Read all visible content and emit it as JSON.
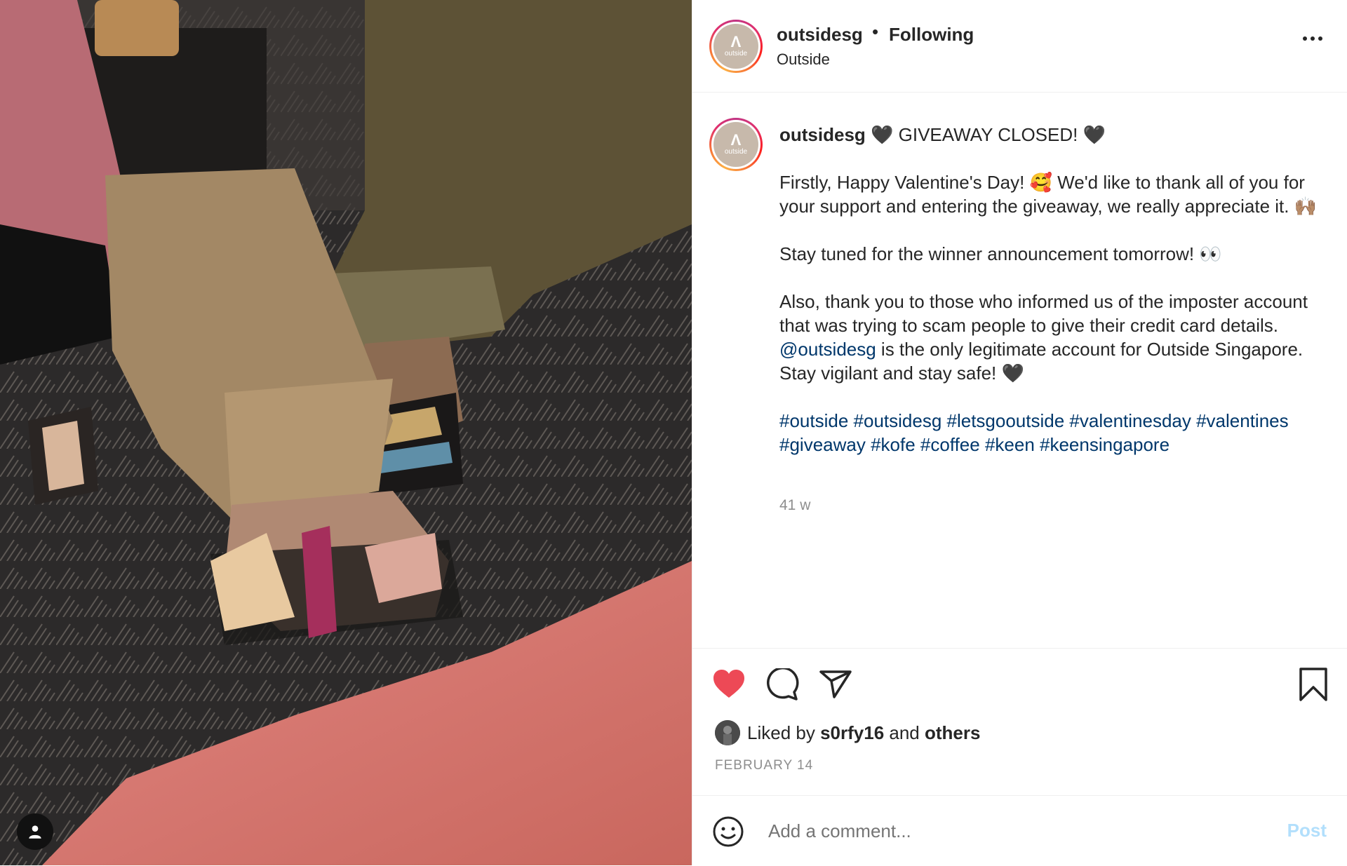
{
  "header": {
    "username": "outsidesg",
    "separator": "•",
    "follow_status": "Following",
    "location": "Outside",
    "avatar_text": "outside",
    "avatar_mark": "Λ"
  },
  "caption": {
    "username": "outsidesg",
    "headline": " 🖤 GIVEAWAY CLOSED! 🖤",
    "p1": "Firstly, Happy Valentine's Day! 🥰 We'd like to thank all of you for your support and entering the giveaway, we really appreciate it. 🙌🏽",
    "p2": "Stay tuned for the winner announcement tomorrow! 👀",
    "p3_before": "Also, thank you to those who informed us of the imposter account that was trying to scam people to give their credit card details. ",
    "p3_mention": "@outsidesg",
    "p3_after": " is the only legitimate account for Outside Singapore. Stay vigilant and stay safe! 🖤",
    "hashtags": "#outside #outsidesg #letsgooutside #valentinesday #valentines #giveaway #kofe #coffee #keen #keensingapore",
    "age": "41 w"
  },
  "actions": {
    "like_color": "#ed4956",
    "liked_prefix": "Liked by ",
    "liked_user": "s0rfy16",
    "liked_mid": " and ",
    "liked_others": "others",
    "date": "FEBRUARY 14"
  },
  "comment": {
    "placeholder": "Add a comment...",
    "post_label": "Post"
  },
  "icons": {
    "like": "heart-icon",
    "comment": "comment-icon",
    "share": "paper-plane-icon",
    "save": "bookmark-icon",
    "emoji": "smiley-icon",
    "more": "ellipsis-icon",
    "tag": "user-tag-icon"
  }
}
